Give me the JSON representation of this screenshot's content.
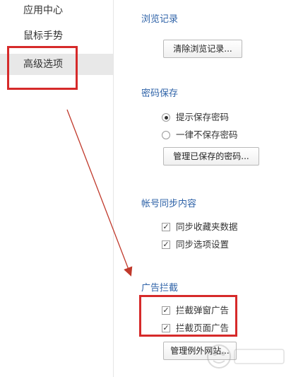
{
  "sidebar": {
    "items": [
      {
        "label": "应用中心",
        "active": false
      },
      {
        "label": "鼠标手势",
        "active": false
      },
      {
        "label": "高级选项",
        "active": true
      }
    ]
  },
  "sections": {
    "browse_history": {
      "title": "浏览记录",
      "clear_button": "清除浏览记录..."
    },
    "password_save": {
      "title": "密码保存",
      "options": [
        {
          "label": "提示保存密码",
          "checked": true
        },
        {
          "label": "一律不保存密码",
          "checked": false
        }
      ],
      "manage_button": "管理已保存的密码..."
    },
    "account_sync": {
      "title": "帐号同步内容",
      "options": [
        {
          "label": "同步收藏夹数据",
          "checked": true
        },
        {
          "label": "同步选项设置",
          "checked": true
        }
      ]
    },
    "ad_block": {
      "title": "广告拦截",
      "options": [
        {
          "label": "拦截弹窗广告",
          "checked": true
        },
        {
          "label": "拦截页面广告",
          "checked": true
        }
      ],
      "manage_button": "管理例外网站..."
    }
  },
  "annotations": {
    "highlight_color": "#d62a2a",
    "arrow_color": "#c0392b"
  }
}
